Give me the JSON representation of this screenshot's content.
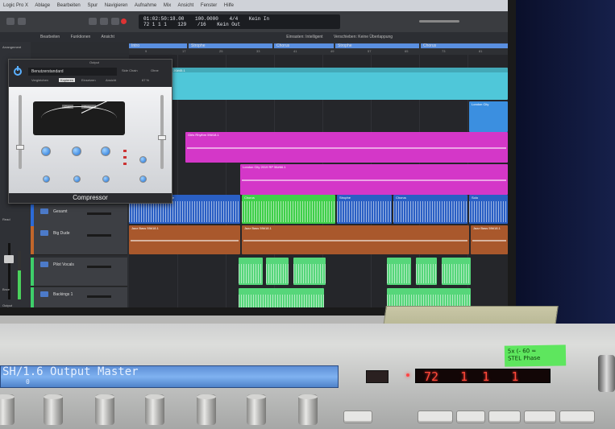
{
  "daw": {
    "menu_items": [
      "Logic Pro X",
      "Ablage",
      "Bearbeiten",
      "Spur",
      "Navigieren",
      "Aufnahme",
      "Mix",
      "Ansicht",
      "Fenster",
      "Hilfe"
    ],
    "lcd": {
      "position_time": "01:02:50:18.00",
      "position_bars": "72  1  1  1",
      "tempo": "100.0000",
      "signature": "4/4",
      "division": "/16",
      "bar_count": "129",
      "input": "Kein In",
      "output": "Kein Out"
    },
    "subbar_items": [
      "Bearbeiten",
      "Funktionen",
      "Ansicht",
      "Einrasten: Intelligent",
      "Verschieben: Keine Überlappung"
    ],
    "sections": [
      {
        "label": "Intro",
        "color": "#5a8fe0"
      },
      {
        "label": "Strophe",
        "color": "#5a8fe0"
      },
      {
        "label": "Chorus",
        "color": "#5a8fe0"
      },
      {
        "label": "Strophe",
        "color": "#5a8fe0"
      },
      {
        "label": "Chorus",
        "color": "#5a8fe0"
      }
    ],
    "ruler_numbers": [
      "9",
      "17",
      "25",
      "33",
      "41",
      "49",
      "57",
      "65",
      "73",
      "81"
    ],
    "left_strip": {
      "label_top": "Arrangement",
      "label_read": "Read",
      "label_output": "Output",
      "label_bnce": "Bnce"
    },
    "tracks": [
      {
        "name": "Gesamt",
        "color": "#2c6bd8"
      },
      {
        "name": "Big Dude",
        "color": "#c2662b"
      },
      {
        "name": "Pilot Vocals",
        "color": "#3ecf6a"
      },
      {
        "name": "Backings 1",
        "color": "#3ecf6a"
      }
    ],
    "regions": {
      "cyan_label": "Strophe · Stimme 20#45.1",
      "magenta_1": "Girls Rhythm 59#18.1",
      "magenta_2": "London City 2019 RP 56#66.1",
      "blue_right": "London City",
      "lane_blue": [
        "Strophe",
        "Chorus",
        "Strophe",
        "Chorus",
        "Solo"
      ],
      "lane_bass": [
        "Jazz Bass 59#18.1",
        "Jazz Bass 59#18.1",
        "Jazz Bass 59#18.1"
      ]
    }
  },
  "plugin": {
    "top_label": "Output",
    "preset": "Benutzerstandard",
    "side_chain": "Side Chain",
    "side_chain_value": "Ohne",
    "tabs": [
      "Vergleichen",
      "Kopieren",
      "Einsetzen",
      "Ansicht",
      "67 %"
    ],
    "meter_mode_a": "Gain",
    "meter_mode_b": "Output",
    "name": "Compressor"
  },
  "surface": {
    "lcd_text": "SH/1.6 Output Master",
    "lcd_sub": "0",
    "counter": "72   1  1   1",
    "sticky_note": "5x (- 60 =\nSTEL Phase"
  }
}
